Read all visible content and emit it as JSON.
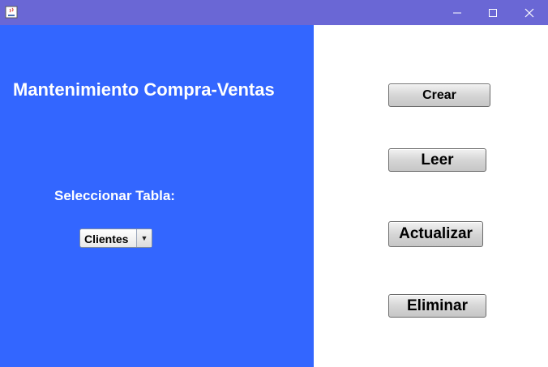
{
  "window": {
    "icon": "java-app-icon",
    "controls": [
      "minimize-icon",
      "maximize-icon",
      "close-icon"
    ]
  },
  "colors": {
    "titlebar": "#6a67d5",
    "left_panel": "#3366ff",
    "right_panel": "#ffffff",
    "label_text": "#ffffff"
  },
  "header": {
    "title": "Mantenimiento Compra-Ventas"
  },
  "table_select": {
    "label": "Seleccionar Tabla:",
    "selected": "Clientes",
    "arrow_icon": "chevron-down-icon"
  },
  "actions": {
    "create": "Crear",
    "read": "Leer",
    "update": "Actualizar",
    "delete": "Eliminar"
  }
}
